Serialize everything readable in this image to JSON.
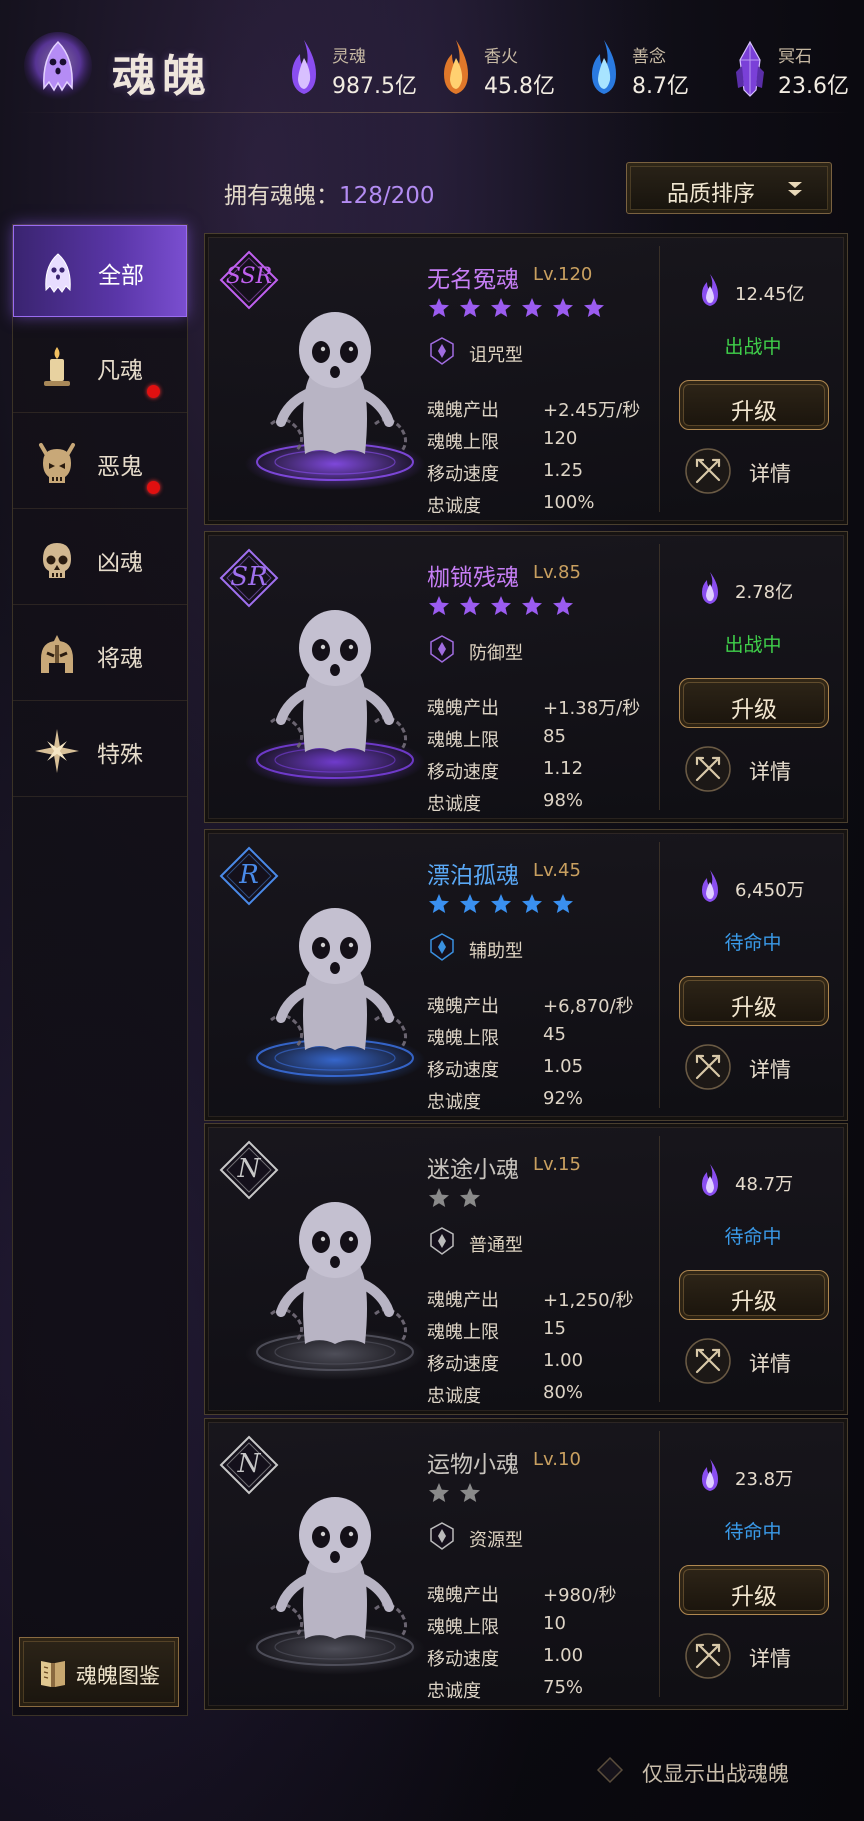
{
  "header": {
    "title": "魂魄",
    "resources": [
      {
        "label": "灵魂",
        "value": "987.5亿",
        "icon": "purple-soul-flame-icon",
        "color": "#a06cf0"
      },
      {
        "label": "香火",
        "value": "45.8亿",
        "icon": "incense-flame-icon",
        "color": "#f2a040"
      },
      {
        "label": "善念",
        "value": "8.7亿",
        "icon": "blue-flame-icon",
        "color": "#4ab0f0"
      },
      {
        "label": "冥石",
        "value": "23.6亿",
        "icon": "nether-crystal-icon",
        "color": "#9a6cf0"
      }
    ]
  },
  "owned": {
    "label": "拥有魂魄：",
    "count": "128/200"
  },
  "sort": {
    "label": "品质排序"
  },
  "sidebar": {
    "items": [
      {
        "label": "全部",
        "icon": "ghost-icon",
        "active": true,
        "dot": false
      },
      {
        "label": "凡魂",
        "icon": "candle-icon",
        "active": false,
        "dot": false
      },
      {
        "label": "恶鬼",
        "icon": "demon-skull-icon",
        "active": false,
        "dot": true
      },
      {
        "label": "凶魂",
        "icon": "skull-icon",
        "active": false,
        "dot": true
      },
      {
        "label": "将魂",
        "icon": "helmet-icon",
        "active": false,
        "dot": false
      },
      {
        "label": "特殊",
        "icon": "star-burst-icon",
        "active": false,
        "dot": false
      }
    ],
    "codex": {
      "label": "魂魄图鉴"
    }
  },
  "stat_labels": [
    "魂魄产出",
    "魂魄上限",
    "移动速度",
    "忠诚度"
  ],
  "upgrade_label": "升级",
  "detail_label": "详情",
  "souls": [
    {
      "rarity": "SSR",
      "rarity_color": "#c060f0",
      "name": "无名冤魂",
      "level": "Lv.120",
      "name_color": "#c67ef5",
      "stars": 6,
      "star_color": "#9b5cf0",
      "type": "诅咒型",
      "type_color": "#a06ce0",
      "stats": [
        "+2.45万/秒",
        "120",
        "1.25",
        "100%"
      ],
      "soul": "12.45亿",
      "status": "出战中",
      "status_color": "#3fcf4a",
      "glow": "#8a4ef0"
    },
    {
      "rarity": "SR",
      "rarity_color": "#a070f0",
      "name": "枷锁残魂",
      "level": "Lv.85",
      "name_color": "#c67ef5",
      "stars": 5,
      "star_color": "#9b5cf0",
      "type": "防御型",
      "type_color": "#a06ce0",
      "stats": [
        "+1.38万/秒",
        "85",
        "1.12",
        "98%"
      ],
      "soul": "2.78亿",
      "status": "出战中",
      "status_color": "#3fcf4a",
      "glow": "#7a40e0"
    },
    {
      "rarity": "R",
      "rarity_color": "#4a8ae8",
      "name": "漂泊孤魂",
      "level": "Lv.45",
      "name_color": "#5aa8f5",
      "stars": 5,
      "star_color": "#3a90f0",
      "type": "辅助型",
      "type_color": "#3a90e0",
      "stats": [
        "+6,870/秒",
        "45",
        "1.05",
        "92%"
      ],
      "soul": "6,450万",
      "status": "待命中",
      "status_color": "#3a9ae8",
      "glow": "#3a70e0"
    },
    {
      "rarity": "N",
      "rarity_color": "#c8c8c8",
      "name": "迷途小魂",
      "level": "Lv.15",
      "name_color": "#c8c4be",
      "stars": 2,
      "star_color": "#8a8a8a",
      "type": "普通型",
      "type_color": "#bbbbbb",
      "stats": [
        "+1,250/秒",
        "15",
        "1.00",
        "80%"
      ],
      "soul": "48.7万",
      "status": "待命中",
      "status_color": "#3a9ae8",
      "glow": "#555560"
    },
    {
      "rarity": "N",
      "rarity_color": "#c8c8c8",
      "name": "运物小魂",
      "level": "Lv.10",
      "name_color": "#c8c4be",
      "stars": 2,
      "star_color": "#8a8a8a",
      "type": "资源型",
      "type_color": "#bbbbbb",
      "stats": [
        "+980/秒",
        "10",
        "1.00",
        "75%"
      ],
      "soul": "23.8万",
      "status": "待命中",
      "status_color": "#3a9ae8",
      "glow": "#555560"
    }
  ],
  "filter": {
    "label": "仅显示出战魂魄"
  }
}
